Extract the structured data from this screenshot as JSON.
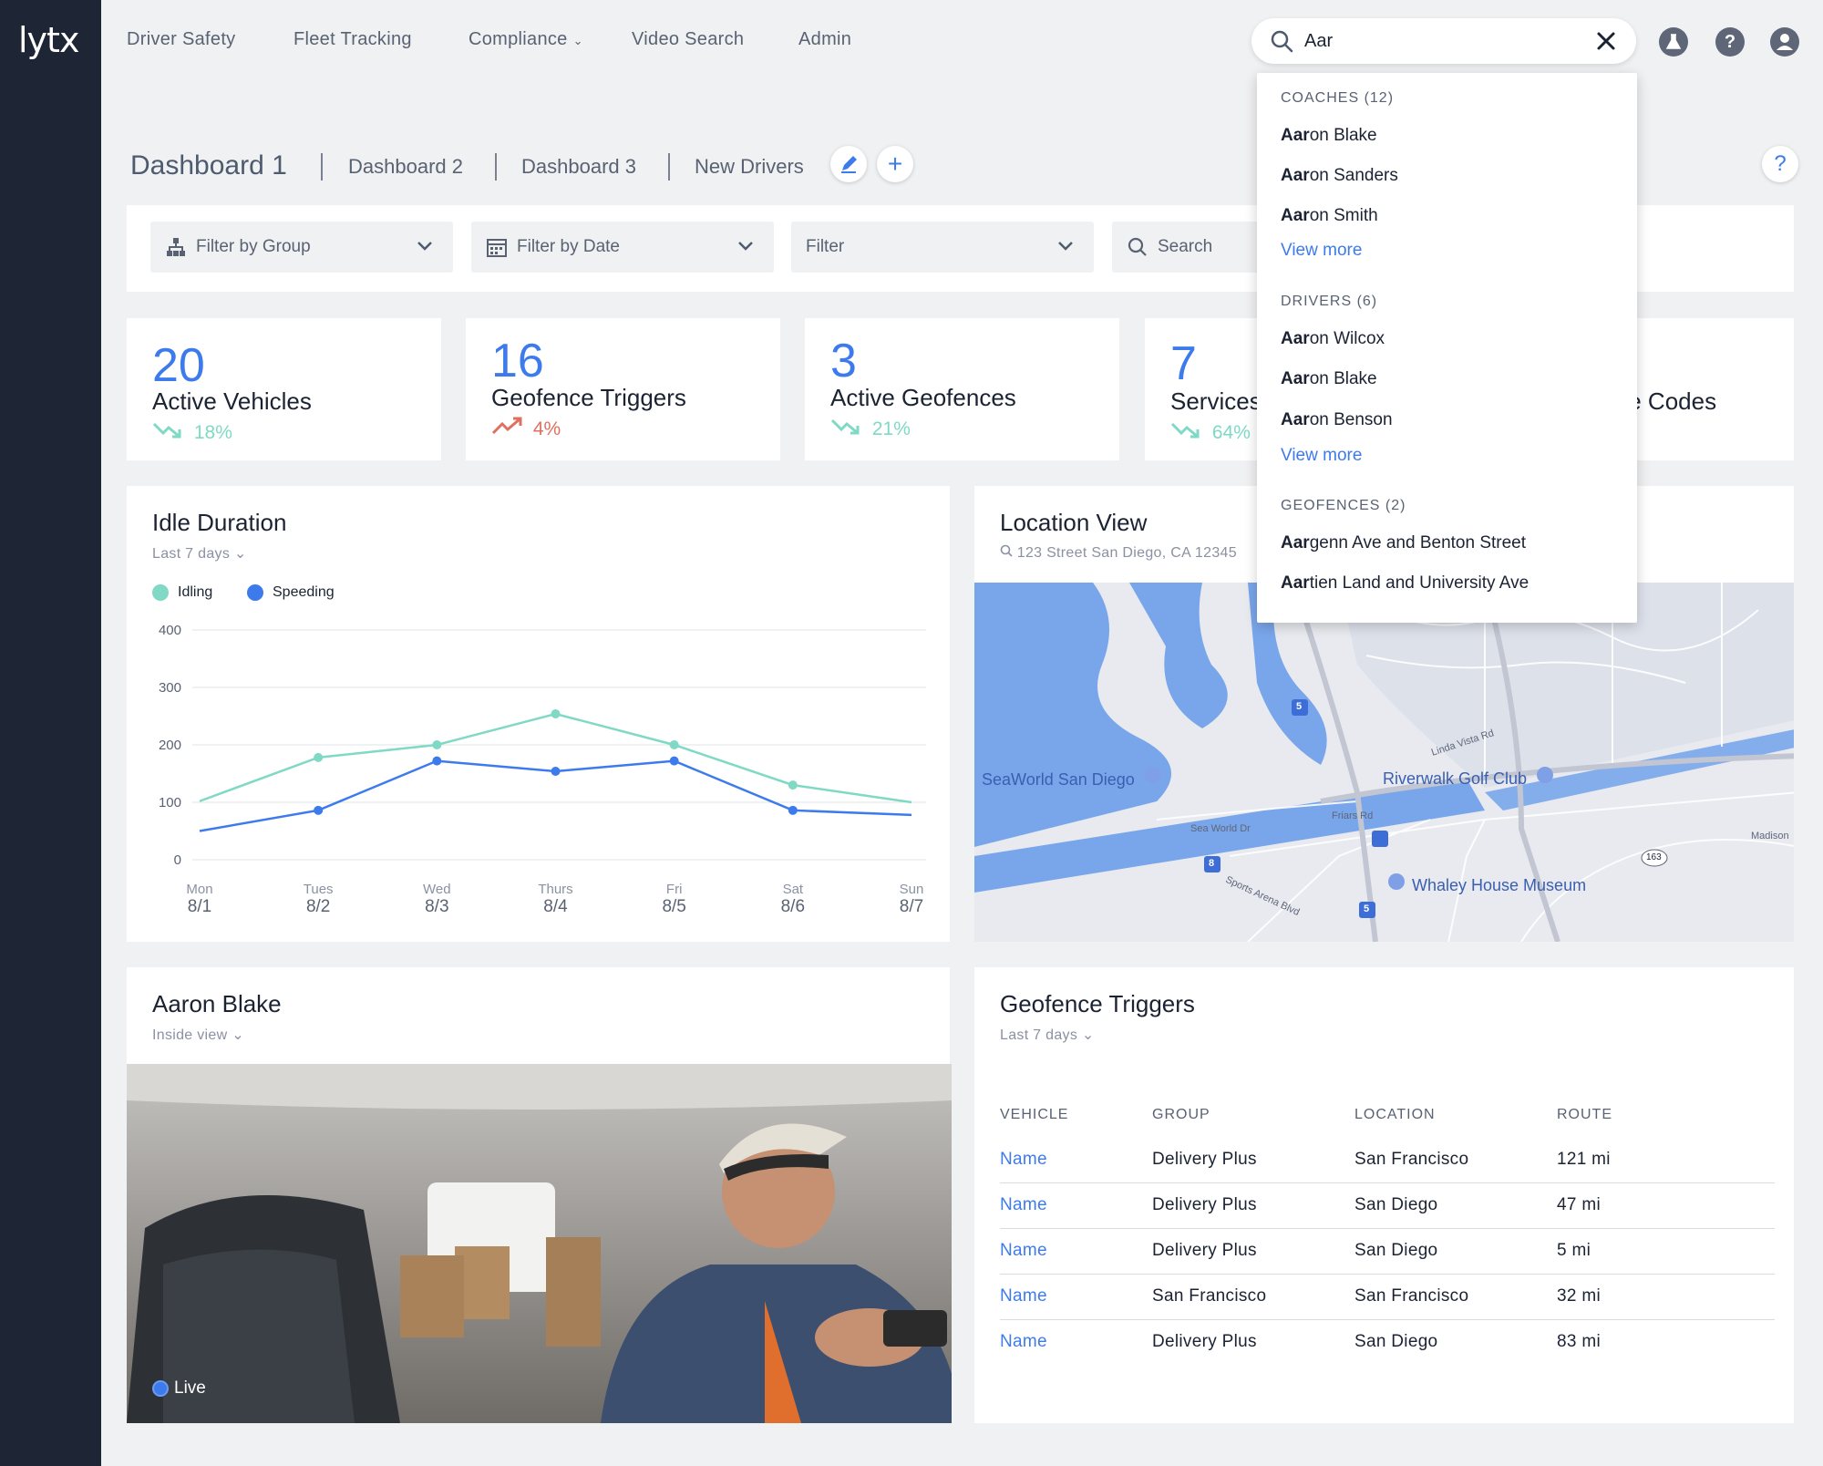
{
  "brand": {
    "logo": "lytx"
  },
  "nav": {
    "items": [
      "Driver Safety",
      "Fleet Tracking",
      "Compliance",
      "Video Search",
      "Admin"
    ]
  },
  "search": {
    "value": "Aar",
    "placeholder": ""
  },
  "tabs": {
    "active": "Dashboard 1",
    "items": [
      "Dashboard 2",
      "Dashboard 3",
      "New Drivers"
    ]
  },
  "filters": {
    "group": "Filter by Group",
    "date": "Filter by Date",
    "filter": "Filter",
    "search": "Search"
  },
  "metrics": [
    {
      "value": "20",
      "label": "Active Vehicles",
      "trend": "18%",
      "direction": "down"
    },
    {
      "value": "16",
      "label": "Geofence Triggers",
      "trend": "4%",
      "direction": "up"
    },
    {
      "value": "3",
      "label": "Active Geofences",
      "trend": "21%",
      "direction": "down"
    },
    {
      "value": "7",
      "label": "Services",
      "trend": "64%",
      "direction": "down"
    },
    {
      "label_fragment": "ble Codes"
    }
  ],
  "idle": {
    "title": "Idle Duration",
    "period": "Last 7 days",
    "legend": [
      "Idling",
      "Speeding"
    ]
  },
  "chart_data": {
    "type": "line",
    "title": "Idle Duration",
    "categories": [
      "Mon",
      "Tues",
      "Wed",
      "Thurs",
      "Fri",
      "Sat",
      "Sun"
    ],
    "dates": [
      "8/1",
      "8/2",
      "8/3",
      "8/4",
      "8/5",
      "8/6",
      "8/7"
    ],
    "yticks": [
      0,
      100,
      200,
      300,
      400
    ],
    "ylim": [
      0,
      400
    ],
    "colors": {
      "Idling": "#7fd9c5",
      "Speeding": "#3d7bec"
    },
    "series": [
      {
        "name": "Idling",
        "values": [
          102,
          178,
          200,
          254,
          200,
          130,
          100
        ]
      },
      {
        "name": "Speeding",
        "values": [
          50,
          86,
          172,
          154,
          172,
          86,
          78
        ]
      }
    ],
    "grid": true,
    "legend_position": "top-left"
  },
  "location": {
    "title": "Location View",
    "address": "123 Street San Diego, CA 12345",
    "map_labels": {
      "seaworld": "SeaWorld San Diego",
      "riverwalk": "Riverwalk Golf Club",
      "whaley": "Whaley House Museum",
      "friars": "Friars Rd",
      "seaworld_dr": "Sea World Dr",
      "sports_arena": "Sports Arena Blvd",
      "linda_vista": "Linda Vista Rd",
      "hwy163": "163",
      "i5a": "5",
      "i8": "8",
      "i5b": "5",
      "madison": "Madison"
    }
  },
  "video": {
    "title": "Aaron Blake",
    "view": "Inside view",
    "status": "Live"
  },
  "geofence": {
    "title": "Geofence Triggers",
    "period": "Last 7 days",
    "columns": [
      "VEHICLE",
      "GROUP",
      "LOCATION",
      "ROUTE"
    ],
    "rows": [
      [
        "Name",
        "Delivery Plus",
        "San Francisco",
        "121 mi"
      ],
      [
        "Name",
        "Delivery Plus",
        "San Diego",
        "47 mi"
      ],
      [
        "Name",
        "Delivery Plus",
        "San Diego",
        "5 mi"
      ],
      [
        "Name",
        "San Francisco",
        "San Francisco",
        "32 mi"
      ],
      [
        "Name",
        "Delivery Plus",
        "San Diego",
        "83 mi"
      ]
    ]
  },
  "dropdown": {
    "coaches": {
      "header": "COACHES (12)",
      "items": [
        {
          "match": "Aar",
          "rest": "on Blake"
        },
        {
          "match": "Aar",
          "rest": "on Sanders"
        },
        {
          "match": "Aar",
          "rest": "on Smith"
        }
      ],
      "more": "View more"
    },
    "drivers": {
      "header": "DRIVERS (6)",
      "items": [
        {
          "match": "Aar",
          "rest": "on Wilcox"
        },
        {
          "match": "Aar",
          "rest": "on Blake"
        },
        {
          "match": "Aar",
          "rest": "on Benson"
        }
      ],
      "more": "View more"
    },
    "geofences": {
      "header": "GEOFENCES (2)",
      "items": [
        {
          "match": "Aar",
          "rest": "genn Ave and Benton Street"
        },
        {
          "match": "Aar",
          "rest": "tien Land and University Ave"
        }
      ]
    }
  },
  "icons": {
    "lab": "flask-icon",
    "help": "help-icon",
    "account": "user-icon"
  },
  "colors": {
    "accent": "#3d7bec",
    "teal": "#7fd9c5",
    "alert": "#e06f5e",
    "sidebar": "#1e2535"
  }
}
